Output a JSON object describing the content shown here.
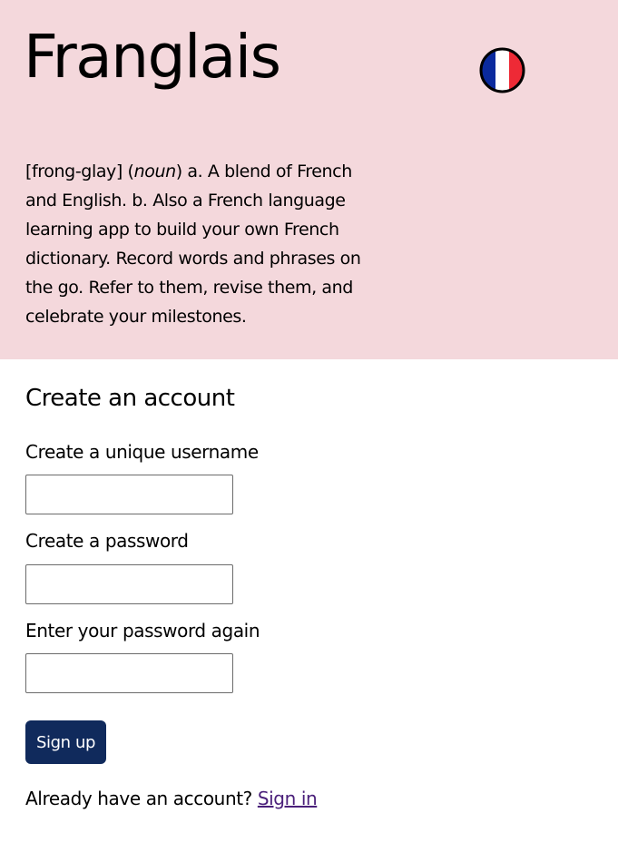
{
  "header": {
    "title": "Franglais",
    "flag_icon": "french-flag-icon"
  },
  "definition": {
    "pronunciation": "[frong-glay] (",
    "part_of_speech": "noun",
    "body": ") a. A blend of French and English. b. Also a French language learning app to build your own French dictionary. Record words and phrases on the go. Refer to them, revise them, and celebrate your milestones."
  },
  "signup": {
    "heading": "Create an account",
    "username_label": "Create a unique username",
    "password_label": "Create a password",
    "password_confirm_label": "Enter your password again",
    "submit_label": "Sign up",
    "signin_prompt": "Already have an account? ",
    "signin_link": "Sign in"
  },
  "colors": {
    "hero_background": "#f4d8dc",
    "button_background": "#102a5c",
    "link": "#4a1f7a",
    "flag_blue": "#0a2a9e",
    "flag_white": "#ffffff",
    "flag_red": "#ee2a36"
  }
}
